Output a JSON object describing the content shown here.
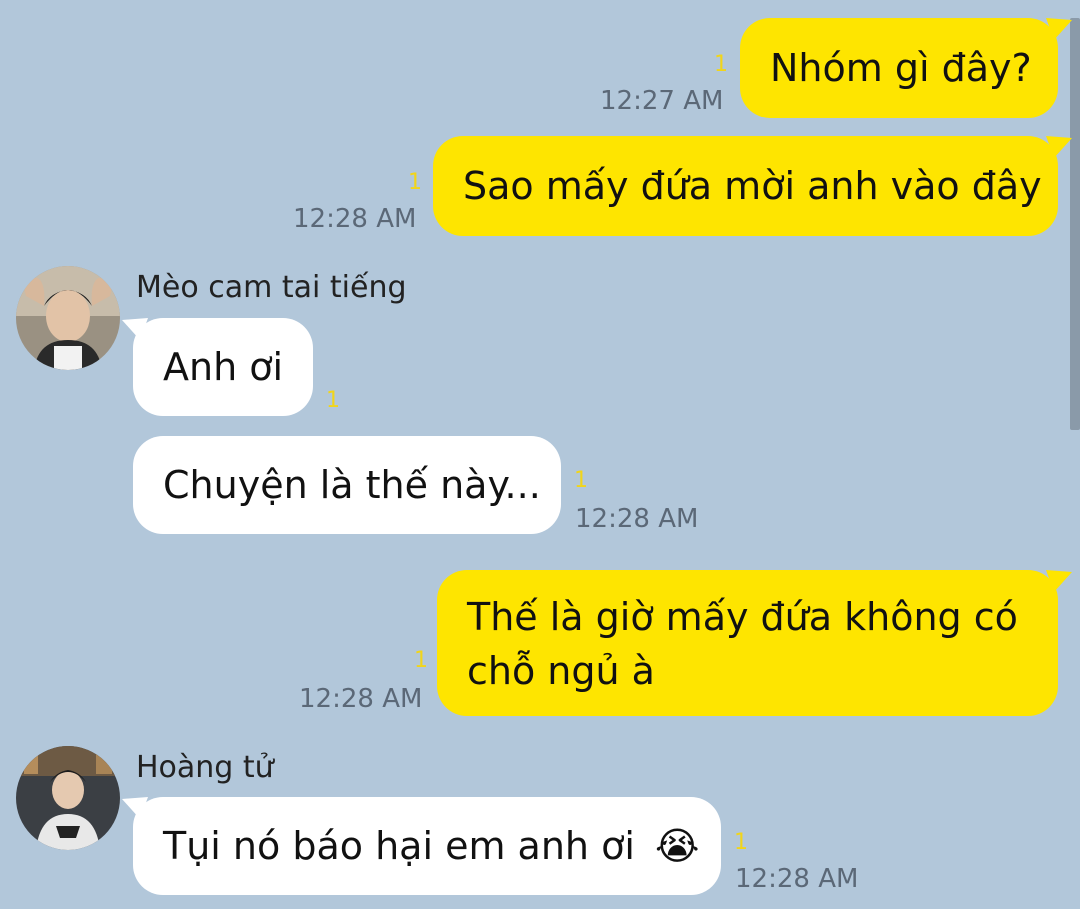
{
  "messages": [
    {
      "sender": "me",
      "text": "Nhóm gì đây?",
      "time": "12:27 AM",
      "unread": "1"
    },
    {
      "sender": "me",
      "text": "Sao mấy đứa mời anh vào đây",
      "time": "12:28 AM",
      "unread": "1"
    },
    {
      "sender": "Mèo cam tai tiếng",
      "text": "Anh ơi",
      "unread": "1"
    },
    {
      "sender": "Mèo cam tai tiếng",
      "text": "Chuyện là thế này...",
      "time": "12:28 AM",
      "unread": "1"
    },
    {
      "sender": "me",
      "text_line1": "Thế là giờ mấy đứa không có",
      "text_line2": "chỗ ngủ à",
      "time": "12:28 AM",
      "unread": "1"
    },
    {
      "sender": "Hoàng tử",
      "text": "Tụi nó báo hại em anh ơi",
      "emoji": "😭",
      "time": "12:28 AM",
      "unread": "1"
    }
  ],
  "contacts": [
    {
      "name": "Mèo cam tai tiếng",
      "avatar_icon": "avatar-photo-icon"
    },
    {
      "name": "Hoàng tử",
      "avatar_icon": "avatar-photo-icon"
    }
  ],
  "colors": {
    "background": "#b2c7da",
    "my_bubble": "#fee500",
    "their_bubble": "#ffffff",
    "unread": "#f1d51a"
  }
}
